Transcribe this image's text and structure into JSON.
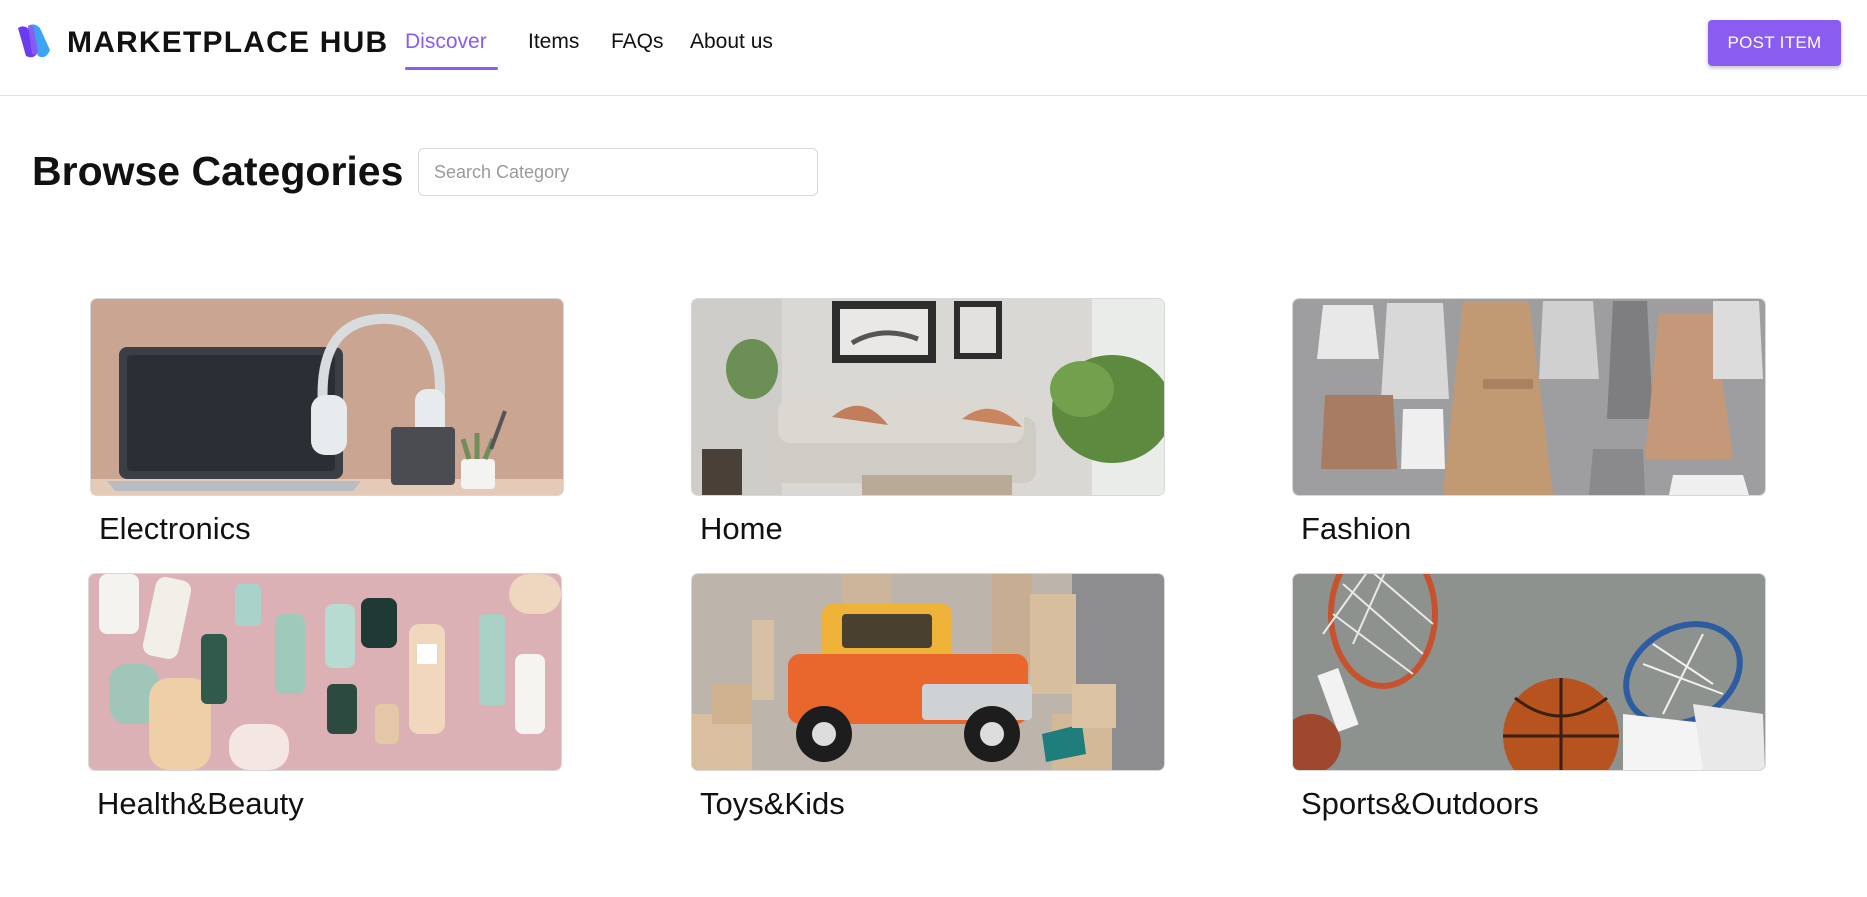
{
  "header": {
    "brand": "MARKETPLACE HUB",
    "nav": [
      {
        "label": "Discover",
        "active": true
      },
      {
        "label": "Items",
        "active": false
      },
      {
        "label": "FAQs",
        "active": false
      },
      {
        "label": "About us",
        "active": false
      }
    ],
    "post_button": "POST ITEM",
    "accent_color": "#8a5cf0"
  },
  "main": {
    "title": "Browse Categories",
    "search": {
      "placeholder": "Search Category",
      "value": ""
    },
    "categories": [
      {
        "label": "Electronics",
        "image": "laptop-headphones-photo"
      },
      {
        "label": "Home",
        "image": "living-room-sofa-photo"
      },
      {
        "label": "Fashion",
        "image": "clothing-flatlay-photo"
      },
      {
        "label": "Health&Beauty",
        "image": "cosmetics-bottles-photo"
      },
      {
        "label": "Toys&Kids",
        "image": "toy-truck-blocks-photo"
      },
      {
        "label": "Sports&Outdoors",
        "image": "rackets-basketball-photo"
      }
    ]
  }
}
